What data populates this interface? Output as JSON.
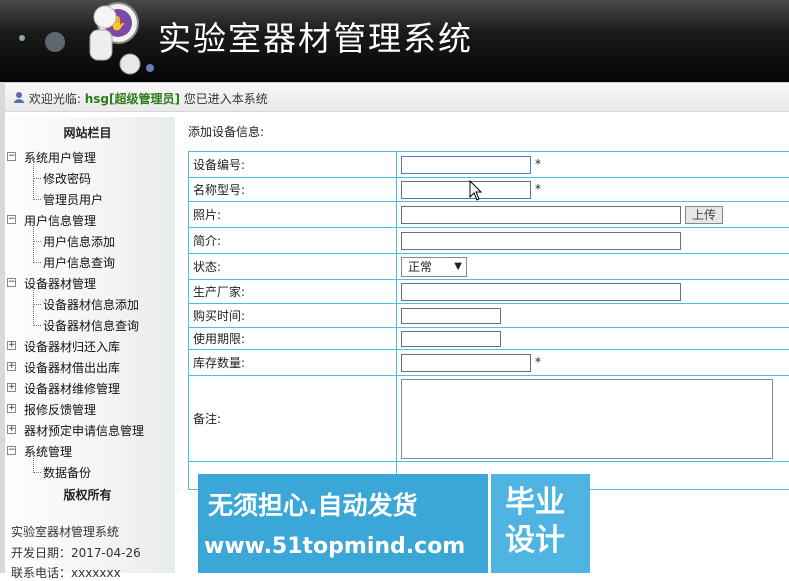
{
  "header": {
    "title": "实验室器材管理系统"
  },
  "welcome": {
    "prefix": "欢迎光临:",
    "user": "hsg[超级管理员]",
    "suffix": "您已进入本系统"
  },
  "sidebar": {
    "title": "网站栏目",
    "tree": [
      {
        "label": "系统用户管理",
        "expanded": true,
        "children": [
          "修改密码",
          "管理员用户"
        ]
      },
      {
        "label": "用户信息管理",
        "expanded": true,
        "children": [
          "用户信息添加",
          "用户信息查询"
        ]
      },
      {
        "label": "设备器材管理",
        "expanded": true,
        "children": [
          "设备器材信息添加",
          "设备器材信息查询"
        ]
      },
      {
        "label": "设备器材归还入库",
        "expanded": false,
        "children": []
      },
      {
        "label": "设备器材借出出库",
        "expanded": false,
        "children": []
      },
      {
        "label": "设备器材维修管理",
        "expanded": false,
        "children": []
      },
      {
        "label": "报修反馈管理",
        "expanded": false,
        "children": []
      },
      {
        "label": "器材预定申请信息管理",
        "expanded": false,
        "children": []
      },
      {
        "label": "系统管理",
        "expanded": true,
        "children": [
          "数据备份"
        ]
      }
    ],
    "copyright_title": "版权所有",
    "info": [
      "实验室器材管理系统",
      "开发日期：2017-04-26",
      "联系电话：xxxxxxx"
    ]
  },
  "form": {
    "section_title": "添加设备信息:",
    "fields": {
      "code": {
        "label": "设备编号:",
        "value": ""
      },
      "model": {
        "label": "名称型号:",
        "value": ""
      },
      "photo": {
        "label": "照片:",
        "value": "",
        "upload": "上传"
      },
      "intro": {
        "label": "简介:",
        "value": ""
      },
      "status": {
        "label": "状态:",
        "value": "正常"
      },
      "maker": {
        "label": "生产厂家:",
        "value": ""
      },
      "buy_date": {
        "label": "购买时间:",
        "value": ""
      },
      "period": {
        "label": "使用期限:",
        "value": ""
      },
      "stock": {
        "label": "库存数量:",
        "value": ""
      },
      "remark": {
        "label": "备注:",
        "value": ""
      }
    },
    "required_mark": "*"
  },
  "banner": {
    "line1": "无须担心.自动发货",
    "line2": "www.51topmind.com",
    "badge": "毕业设计"
  }
}
